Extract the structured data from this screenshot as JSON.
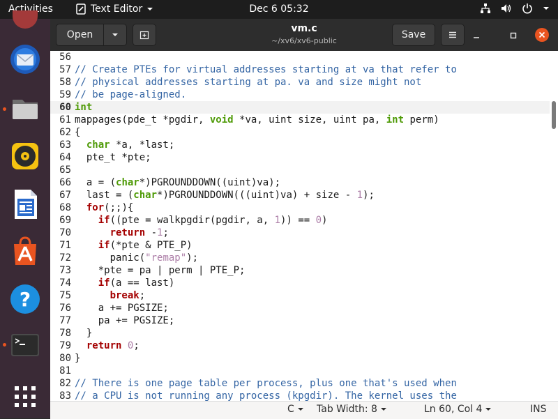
{
  "topbar": {
    "activities": "Activities",
    "app_menu": "Text Editor",
    "clock": "Dec 6  05:32"
  },
  "dock": {
    "items": [
      "thunderbird-icon",
      "files-icon",
      "rhythmbox-icon",
      "libreoffice-writer-icon",
      "software-center-icon",
      "help-icon",
      "terminal-icon"
    ]
  },
  "header": {
    "open_label": "Open",
    "save_label": "Save",
    "title": "vm.c",
    "subtitle": "~/xv6/xv6-public"
  },
  "editor": {
    "current_line": 60,
    "lines": [
      {
        "n": "56",
        "tokens": []
      },
      {
        "n": "57",
        "tokens": [
          [
            "comment",
            "// Create PTEs for virtual addresses starting at va that refer to"
          ]
        ]
      },
      {
        "n": "58",
        "tokens": [
          [
            "comment",
            "// physical addresses starting at pa. va and size might not"
          ]
        ]
      },
      {
        "n": "59",
        "tokens": [
          [
            "comment",
            "// be page-aligned."
          ]
        ]
      },
      {
        "n": "60",
        "tokens": [
          [
            "type",
            "int"
          ]
        ]
      },
      {
        "n": "61",
        "tokens": [
          [
            "plain",
            "mappages(pde_t *pgdir, "
          ],
          [
            "type",
            "void"
          ],
          [
            "plain",
            " *va, uint size, uint pa, "
          ],
          [
            "type",
            "int"
          ],
          [
            "plain",
            " perm)"
          ]
        ]
      },
      {
        "n": "62",
        "tokens": [
          [
            "plain",
            "{"
          ]
        ]
      },
      {
        "n": "63",
        "tokens": [
          [
            "plain",
            "  "
          ],
          [
            "type",
            "char"
          ],
          [
            "plain",
            " *a, *last;"
          ]
        ]
      },
      {
        "n": "64",
        "tokens": [
          [
            "plain",
            "  pte_t *pte;"
          ]
        ]
      },
      {
        "n": "65",
        "tokens": []
      },
      {
        "n": "66",
        "tokens": [
          [
            "plain",
            "  a = ("
          ],
          [
            "type",
            "char"
          ],
          [
            "plain",
            "*)PGROUNDDOWN((uint)va);"
          ]
        ]
      },
      {
        "n": "67",
        "tokens": [
          [
            "plain",
            "  last = ("
          ],
          [
            "type",
            "char"
          ],
          [
            "plain",
            "*)PGROUNDDOWN(((uint)va) + size - "
          ],
          [
            "num",
            "1"
          ],
          [
            "plain",
            ");"
          ]
        ]
      },
      {
        "n": "68",
        "tokens": [
          [
            "plain",
            "  "
          ],
          [
            "kw",
            "for"
          ],
          [
            "plain",
            "(;;){"
          ]
        ]
      },
      {
        "n": "69",
        "tokens": [
          [
            "plain",
            "    "
          ],
          [
            "kw",
            "if"
          ],
          [
            "plain",
            "((pte = walkpgdir(pgdir, a, "
          ],
          [
            "num",
            "1"
          ],
          [
            "plain",
            ")) == "
          ],
          [
            "num",
            "0"
          ],
          [
            "plain",
            ")"
          ]
        ]
      },
      {
        "n": "70",
        "tokens": [
          [
            "plain",
            "      "
          ],
          [
            "kw",
            "return"
          ],
          [
            "plain",
            " -"
          ],
          [
            "num",
            "1"
          ],
          [
            "plain",
            ";"
          ]
        ]
      },
      {
        "n": "71",
        "tokens": [
          [
            "plain",
            "    "
          ],
          [
            "kw",
            "if"
          ],
          [
            "plain",
            "(*pte & PTE_P)"
          ]
        ]
      },
      {
        "n": "72",
        "tokens": [
          [
            "plain",
            "      panic("
          ],
          [
            "str",
            "\"remap\""
          ],
          [
            "plain",
            ");"
          ]
        ]
      },
      {
        "n": "73",
        "tokens": [
          [
            "plain",
            "    *pte = pa | perm | PTE_P;"
          ]
        ]
      },
      {
        "n": "74",
        "tokens": [
          [
            "plain",
            "    "
          ],
          [
            "kw",
            "if"
          ],
          [
            "plain",
            "(a == last)"
          ]
        ]
      },
      {
        "n": "75",
        "tokens": [
          [
            "plain",
            "      "
          ],
          [
            "kw",
            "break"
          ],
          [
            "plain",
            ";"
          ]
        ]
      },
      {
        "n": "76",
        "tokens": [
          [
            "plain",
            "    a += PGSIZE;"
          ]
        ]
      },
      {
        "n": "77",
        "tokens": [
          [
            "plain",
            "    pa += PGSIZE;"
          ]
        ]
      },
      {
        "n": "78",
        "tokens": [
          [
            "plain",
            "  }"
          ]
        ]
      },
      {
        "n": "79",
        "tokens": [
          [
            "plain",
            "  "
          ],
          [
            "kw",
            "return"
          ],
          [
            "plain",
            " "
          ],
          [
            "num",
            "0"
          ],
          [
            "plain",
            ";"
          ]
        ]
      },
      {
        "n": "80",
        "tokens": [
          [
            "plain",
            "}"
          ]
        ]
      },
      {
        "n": "81",
        "tokens": []
      },
      {
        "n": "82",
        "tokens": [
          [
            "comment",
            "// There is one page table per process, plus one that's used when"
          ]
        ]
      },
      {
        "n": "83",
        "tokens": [
          [
            "comment",
            "// a CPU is not running any process (kpgdir). The kernel uses the"
          ]
        ]
      }
    ]
  },
  "status": {
    "language": "C",
    "tab_width": "Tab Width: 8",
    "position": "Ln 60, Col 4",
    "mode": "INS"
  },
  "colors": {
    "accent": "#e95420",
    "comment": "#3465a4",
    "type": "#4e9a06",
    "keyword": "#a40000",
    "number": "#ad7fa8"
  }
}
